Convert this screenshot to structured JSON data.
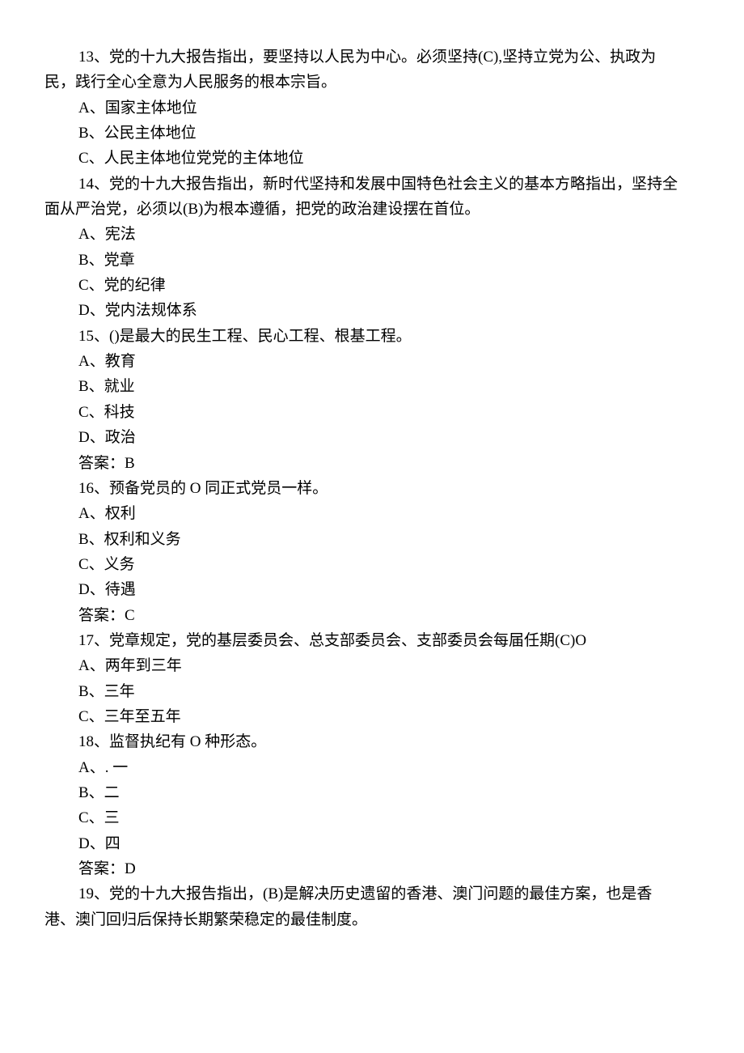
{
  "q13": {
    "stem1": "13、党的十九大报告指出，要坚持以人民为中心。必须坚持(C),坚持立党为公、执政为",
    "stem2": "民，践行全心全意为人民服务的根本宗旨。",
    "optA": "A、国家主体地位",
    "optB": "B、公民主体地位",
    "optC": "C、人民主体地位党党的主体地位"
  },
  "q14": {
    "stem1": "14、党的十九大报告指出，新时代坚持和发展中国特色社会主义的基本方略指出，坚持全",
    "stem2": "面从严治党，必须以(B)为根本遵循，把党的政治建设摆在首位。",
    "optA": "A、宪法",
    "optB": "B、党章",
    "optC": "C、党的纪律",
    "optD": "D、党内法规体系"
  },
  "q15": {
    "stem": "15、()是最大的民生工程、民心工程、根基工程。",
    "optA": "A、教育",
    "optB": "B、就业",
    "optC": "C、科技",
    "optD": "D、政治",
    "answer": "答案：B"
  },
  "q16": {
    "stem": "16、预备党员的 O 同正式党员一样。",
    "optA": "A、权利",
    "optB": "B、权利和义务",
    "optC": "C、义务",
    "optD": "D、待遇",
    "answer": "答案：C"
  },
  "q17": {
    "stem": "17、党章规定，党的基层委员会、总支部委员会、支部委员会每届任期(C)O",
    "optA": "A、两年到三年",
    "optB": "B、三年",
    "optC": "C、三年至五年"
  },
  "q18": {
    "stem": "18、监督执纪有 O 种形态。",
    "optA": "A、. 一",
    "optB": "B、二",
    "optC": "C、三",
    "optD": "D、四",
    "answer": "答案：D"
  },
  "q19": {
    "stem1": "19、党的十九大报告指出，(B)是解决历史遗留的香港、澳门问题的最佳方案，也是香",
    "stem2": "港、澳门回归后保持长期繁荣稳定的最佳制度。"
  }
}
